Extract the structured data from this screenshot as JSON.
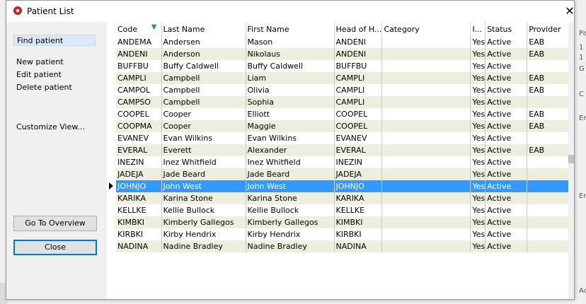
{
  "window": {
    "title": "Patient List",
    "close_glyph": "✕"
  },
  "sidebar": {
    "find": "Find patient",
    "new": "New patient",
    "edit": "Edit patient",
    "delete": "Delete patient",
    "customize": "Customize View...",
    "overview_button": "Go To Overview",
    "close_button": "Close"
  },
  "table": {
    "columns": [
      "Code",
      "Last Name",
      "First Name",
      "Head of H...",
      "Category",
      "I...",
      "Status",
      "Provider"
    ],
    "sort_icon": "sort-arrow-icon",
    "selected_row": 12,
    "rows": [
      [
        "ANDEMA",
        "Andersen",
        "Mason",
        "ANDENI",
        "",
        "Yes",
        "Active",
        "EAB"
      ],
      [
        "ANDENI",
        "Anderson",
        "Nikolaus",
        "ANDENI",
        "",
        "Yes",
        "Active",
        "EAB"
      ],
      [
        "BUFFBU",
        "Buffy Caldwell",
        "Buffy Caldwell",
        "BUFFBU",
        "",
        "Yes",
        "Active",
        ""
      ],
      [
        "CAMPLI",
        "Campbell",
        "Liam",
        "CAMPLI",
        "",
        "Yes",
        "Active",
        "EAB"
      ],
      [
        "CAMPOL",
        "Campbell",
        "Olivia",
        "CAMPLI",
        "",
        "Yes",
        "Active",
        "EAB"
      ],
      [
        "CAMPSO",
        "Campbell",
        "Sophia",
        "CAMPLI",
        "",
        "Yes",
        "Active",
        ""
      ],
      [
        "COOPEL",
        "Cooper",
        "Elliott",
        "COOPEL",
        "",
        "Yes",
        "Active",
        "EAB"
      ],
      [
        "COOPMA",
        "Cooper",
        "Maggie",
        "COOPEL",
        "",
        "Yes",
        "Active",
        "EAB"
      ],
      [
        "EVANEV",
        "Evan Wilkins",
        "Evan Wilkins",
        "EVANEV",
        "",
        "Yes",
        "Active",
        ""
      ],
      [
        "EVERAL",
        "Everett",
        "Alexander",
        "EVERAL",
        "",
        "Yes",
        "Active",
        "EAB"
      ],
      [
        "INEZIN",
        "Inez Whitfield",
        "Inez Whitfield",
        "INEZIN",
        "",
        "Yes",
        "Active",
        ""
      ],
      [
        "JADEJA",
        "Jade Beard",
        "Jade Beard",
        "JADEJA",
        "",
        "Yes",
        "Active",
        ""
      ],
      [
        "JOHNJO",
        "John West",
        "John West",
        "JOHNJO",
        "",
        "Yes",
        "Active",
        ""
      ],
      [
        "KARIKA",
        "Karina Stone",
        "Karina Stone",
        "KARIKA",
        "",
        "Yes",
        "Active",
        ""
      ],
      [
        "KELLKE",
        "Kellie Bullock",
        "Kellie Bullock",
        "KELLKE",
        "",
        "Yes",
        "Active",
        ""
      ],
      [
        "KIMBKI",
        "Kimberly Gallegos",
        "Kimberly Gallegos",
        "KIMBKI",
        "",
        "Yes",
        "Active",
        ""
      ],
      [
        "KIRBKI",
        "Kirby Hendrix",
        "Kirby Hendrix",
        "KIRBKI",
        "",
        "Yes",
        "Active",
        ""
      ],
      [
        "NADINA",
        "Nadine Bradley",
        "Nadine Bradley",
        "NADINA",
        "",
        "Yes",
        "Active",
        ""
      ]
    ]
  },
  "background_app": {
    "right_edge_letters": [
      "Pa",
      "1",
      "1",
      "G",
      "C",
      "Er",
      "Er"
    ],
    "bottom_right_text": "Ac"
  }
}
